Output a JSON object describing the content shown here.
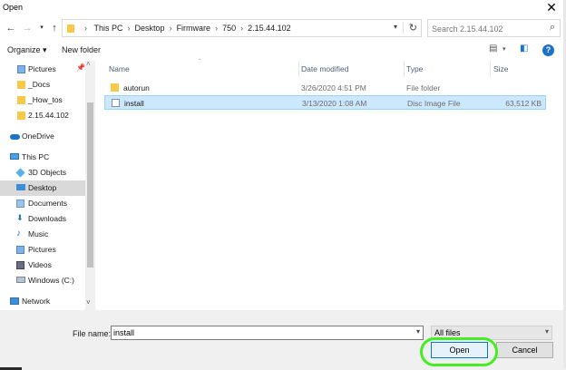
{
  "window": {
    "title": "Open"
  },
  "address": {
    "crumbs": [
      "This PC",
      "Desktop",
      "Firmware",
      "750",
      "2.15.44.102"
    ]
  },
  "search": {
    "placeholder": "Search 2.15.44.102"
  },
  "toolbar": {
    "organize_label": "Organize ▾",
    "new_folder_label": "New folder"
  },
  "sidebar": {
    "items": [
      {
        "label": "Pictures",
        "icon": "pictures-icon",
        "pinned": true
      },
      {
        "label": "_Docs",
        "icon": "folder-icon"
      },
      {
        "label": "_How_tos",
        "icon": "folder-icon"
      },
      {
        "label": "2.15.44.102",
        "icon": "folder-icon"
      },
      {
        "label": "OneDrive",
        "icon": "onedrive-icon"
      },
      {
        "label": "This PC",
        "icon": "this-pc-icon"
      },
      {
        "label": "3D Objects",
        "icon": "3d-objects-icon"
      },
      {
        "label": "Desktop",
        "icon": "desktop-icon",
        "selected": true
      },
      {
        "label": "Documents",
        "icon": "documents-icon"
      },
      {
        "label": "Downloads",
        "icon": "downloads-icon"
      },
      {
        "label": "Music",
        "icon": "music-icon"
      },
      {
        "label": "Pictures",
        "icon": "pictures-icon"
      },
      {
        "label": "Videos",
        "icon": "videos-icon"
      },
      {
        "label": "Windows (C:)",
        "icon": "drive-icon"
      },
      {
        "label": "Network",
        "icon": "network-icon"
      }
    ]
  },
  "filelist": {
    "columns": [
      "Name",
      "Date modified",
      "Type",
      "Size"
    ],
    "rows": [
      {
        "name": "autorun",
        "date": "3/26/2020 4:51 PM",
        "type": "File folder",
        "size": "",
        "icon": "folder-icon"
      },
      {
        "name": "install",
        "date": "3/13/2020 1:08 AM",
        "type": "Disc Image File",
        "size": "63,512 KB",
        "icon": "disc-image-icon",
        "selected": true
      }
    ]
  },
  "bottom": {
    "filename_label": "File name:",
    "filename_value": "install",
    "filetype_value": "All files",
    "open_label": "Open",
    "cancel_label": "Cancel"
  },
  "colors": {
    "selection_bg": "#cce8ff",
    "highlight_ring": "#44ee22",
    "folder": "#f7c948",
    "accent": "#0078d7"
  }
}
